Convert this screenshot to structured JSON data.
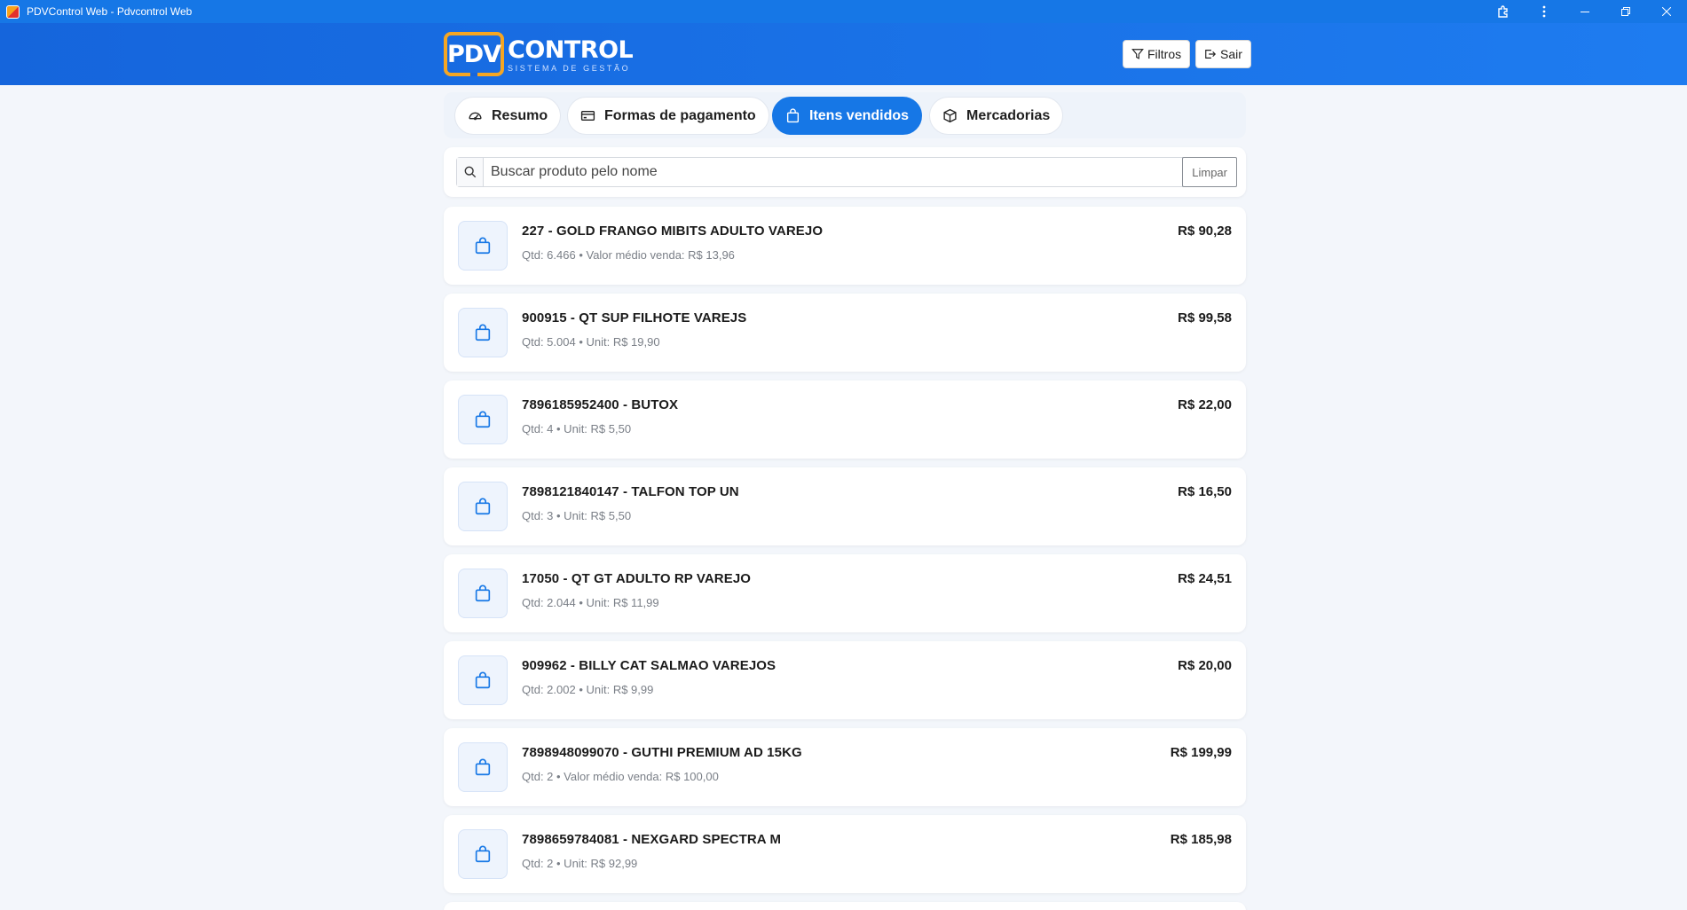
{
  "window": {
    "title": "PDVControl Web - Pdvcontrol Web"
  },
  "header": {
    "logo_box": "PDV",
    "logo_word": "CONTROL",
    "logo_sub": "SISTEMA DE GESTÃO",
    "filters_label": "Filtros",
    "exit_label": "Sair"
  },
  "tabs": [
    {
      "label": "Resumo",
      "icon": "dashboard-icon",
      "active": false
    },
    {
      "label": "Formas de pagamento",
      "icon": "credit-card-icon",
      "active": false
    },
    {
      "label": "Itens vendidos",
      "icon": "shopping-bag-icon",
      "active": true
    },
    {
      "label": "Mercadorias",
      "icon": "box-icon",
      "active": false
    }
  ],
  "search": {
    "placeholder": "Buscar produto pelo nome",
    "value": "",
    "clear_label": "Limpar"
  },
  "items": [
    {
      "title": "227 - GOLD FRANGO MIBITS ADULTO VAREJO",
      "sub": "Qtd: 6.466 • Valor médio venda: R$ 13,96",
      "price": "R$ 90,28"
    },
    {
      "title": "900915 - QT SUP FILHOTE VAREJS",
      "sub": "Qtd: 5.004 • Unit: R$ 19,90",
      "price": "R$ 99,58"
    },
    {
      "title": "7896185952400 - BUTOX",
      "sub": "Qtd: 4 • Unit: R$ 5,50",
      "price": "R$ 22,00"
    },
    {
      "title": "7898121840147 - TALFON TOP UN",
      "sub": "Qtd: 3 • Unit: R$ 5,50",
      "price": "R$ 16,50"
    },
    {
      "title": "17050 - QT GT ADULTO RP VAREJO",
      "sub": "Qtd: 2.044 • Unit: R$ 11,99",
      "price": "R$ 24,51"
    },
    {
      "title": "909962 - BILLY CAT SALMAO VAREJOS",
      "sub": "Qtd: 2.002 • Unit: R$ 9,99",
      "price": "R$ 20,00"
    },
    {
      "title": "7898948099070 - GUTHI PREMIUM AD 15KG",
      "sub": "Qtd: 2 • Valor médio venda: R$ 100,00",
      "price": "R$ 199,99"
    },
    {
      "title": "7898659784081 - NEXGARD SPECTRA M",
      "sub": "Qtd: 2 • Unit: R$ 92,99",
      "price": "R$ 185,98"
    }
  ],
  "colors": {
    "brand": "#1677e6",
    "logo_accent": "#f5a623",
    "background": "#f3f6fb"
  }
}
